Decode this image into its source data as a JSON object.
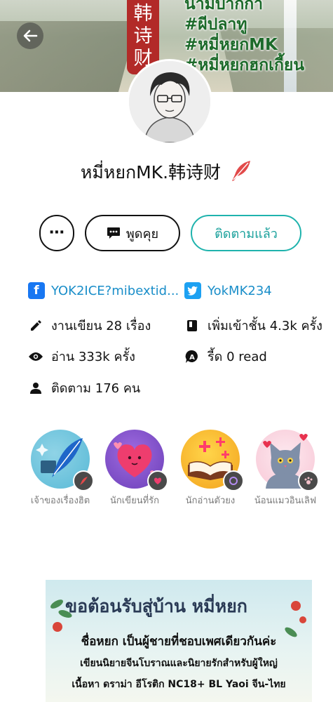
{
  "cover": {
    "red_label": "韩诗财",
    "tags": [
      "นามปากกา",
      "#ผีปลาทู",
      "#หมี่หยกMK",
      "#หมี่หยกฮกเกี้ยน"
    ]
  },
  "back_icon": "arrow-left-icon",
  "profile": {
    "name": "หมี่หยกMK.韩诗财"
  },
  "actions": {
    "more": "⋯",
    "chat": "พูดคุย",
    "follow": "ติดตามแล้ว"
  },
  "socials": {
    "facebook": "YOK2ICE?mibextid...",
    "twitter": "YokMK234"
  },
  "stats": {
    "works": "งานเขียน 28 เรื่อง",
    "library": "เพิ่มเข้าชั้น 4.3k ครั้ง",
    "reads": "อ่าน 333k ครั้ง",
    "read_count": "รี้ด 0 read",
    "followers": "ติดตาม 176 คน"
  },
  "badges": [
    {
      "label": "เจ้าของเรื่องฮิต",
      "icon": "quill-icon"
    },
    {
      "label": "นักเขียนที่รัก",
      "icon": "heart-icon"
    },
    {
      "label": "นักอ่านตัวยง",
      "icon": "book-icon"
    },
    {
      "label": "น้อนแมวอินเลิฟ",
      "icon": "cat-icon"
    }
  ],
  "banner": {
    "title": "ขอต้อนรับสู่บ้าน หมี่หยก",
    "line1": "ชื่อหยก เป็นผู้ชายที่ชอบเพศเดียวกันค่ะ",
    "line2": "เขียนนิยายจีนโบราณและนิยายรักสำหรับผู้ใหญ่",
    "line3": "เนื้อหา ดราม่า อีโรติก NC18+ BL Yaoi จีน-ไทย"
  },
  "colors": {
    "accent": "#1fb3ad",
    "link": "#1a8ec9",
    "facebook": "#1877f2",
    "twitter": "#1da1f2"
  }
}
